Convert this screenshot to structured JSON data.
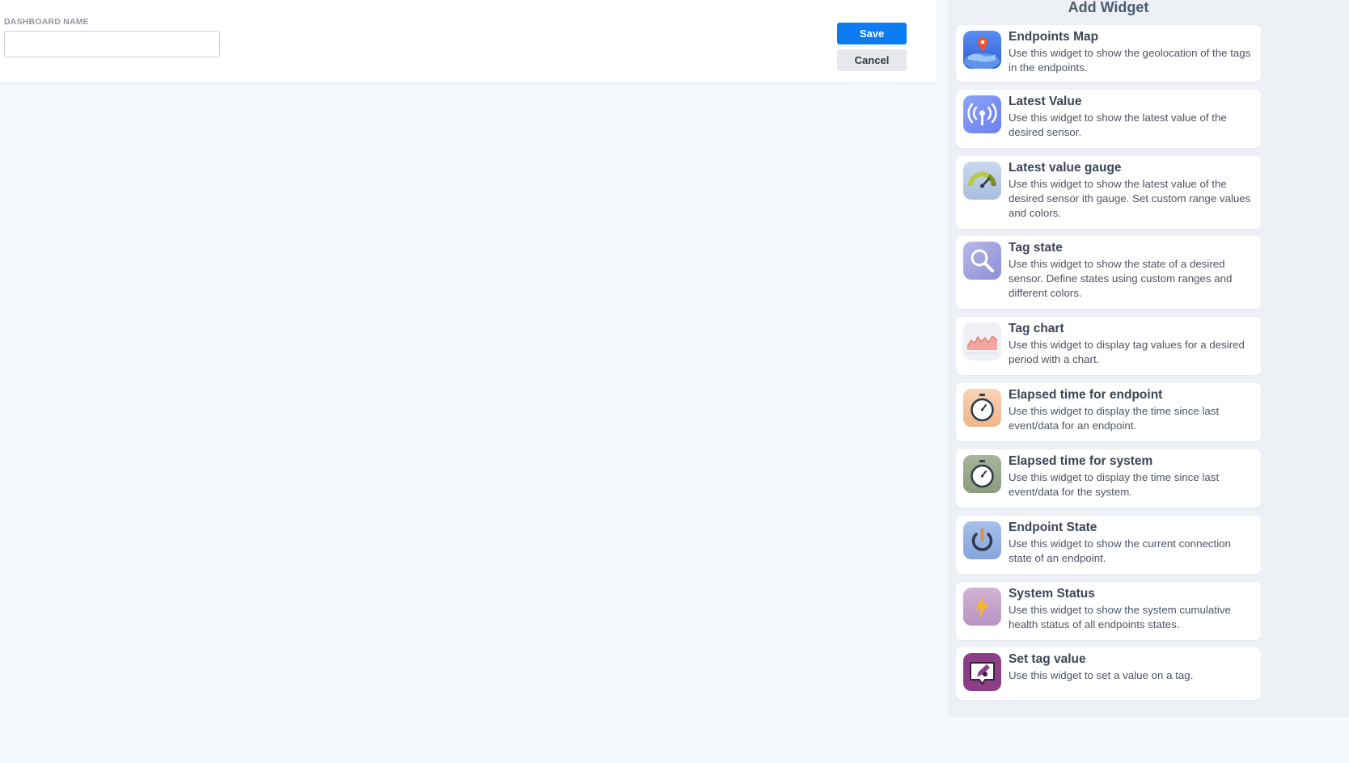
{
  "form": {
    "dashboard_name_label": "DASHBOARD NAME",
    "dashboard_name_value": "",
    "save_label": "Save",
    "cancel_label": "Cancel"
  },
  "panel": {
    "title": "Add Widget",
    "widgets": [
      {
        "title": "Endpoints Map",
        "desc": "Use this widget to show the geolocation of the tags in the endpoints.",
        "icon": "globe-pin-icon"
      },
      {
        "title": "Latest Value",
        "desc": "Use this widget to show the latest value of the desired sensor.",
        "icon": "broadcast-icon"
      },
      {
        "title": "Latest value gauge",
        "desc": "Use this widget to show the latest value of the desired sensor ith gauge. Set custom range values and colors.",
        "icon": "gauge-icon"
      },
      {
        "title": "Tag state",
        "desc": "Use this widget to show the state of a desired sensor. Define states using custom ranges and different colors.",
        "icon": "magnifier-icon"
      },
      {
        "title": "Tag chart",
        "desc": "Use this widget to display tag values for a desired period with a chart.",
        "icon": "area-chart-icon"
      },
      {
        "title": "Elapsed time for endpoint",
        "desc": "Use this widget to display the time since last event/data for an endpoint.",
        "icon": "stopwatch-icon"
      },
      {
        "title": "Elapsed time for system",
        "desc": "Use this widget to display the time since last event/data for the system.",
        "icon": "stopwatch-icon"
      },
      {
        "title": "Endpoint State",
        "desc": "Use this widget to show the current connection state of an endpoint.",
        "icon": "power-icon"
      },
      {
        "title": "System Status",
        "desc": "Use this widget to show the system cumulative health status of all endpoints states.",
        "icon": "lightning-icon"
      },
      {
        "title": "Set tag value",
        "desc": "Use this widget to set a value on a tag.",
        "icon": "edit-tag-icon"
      }
    ]
  }
}
